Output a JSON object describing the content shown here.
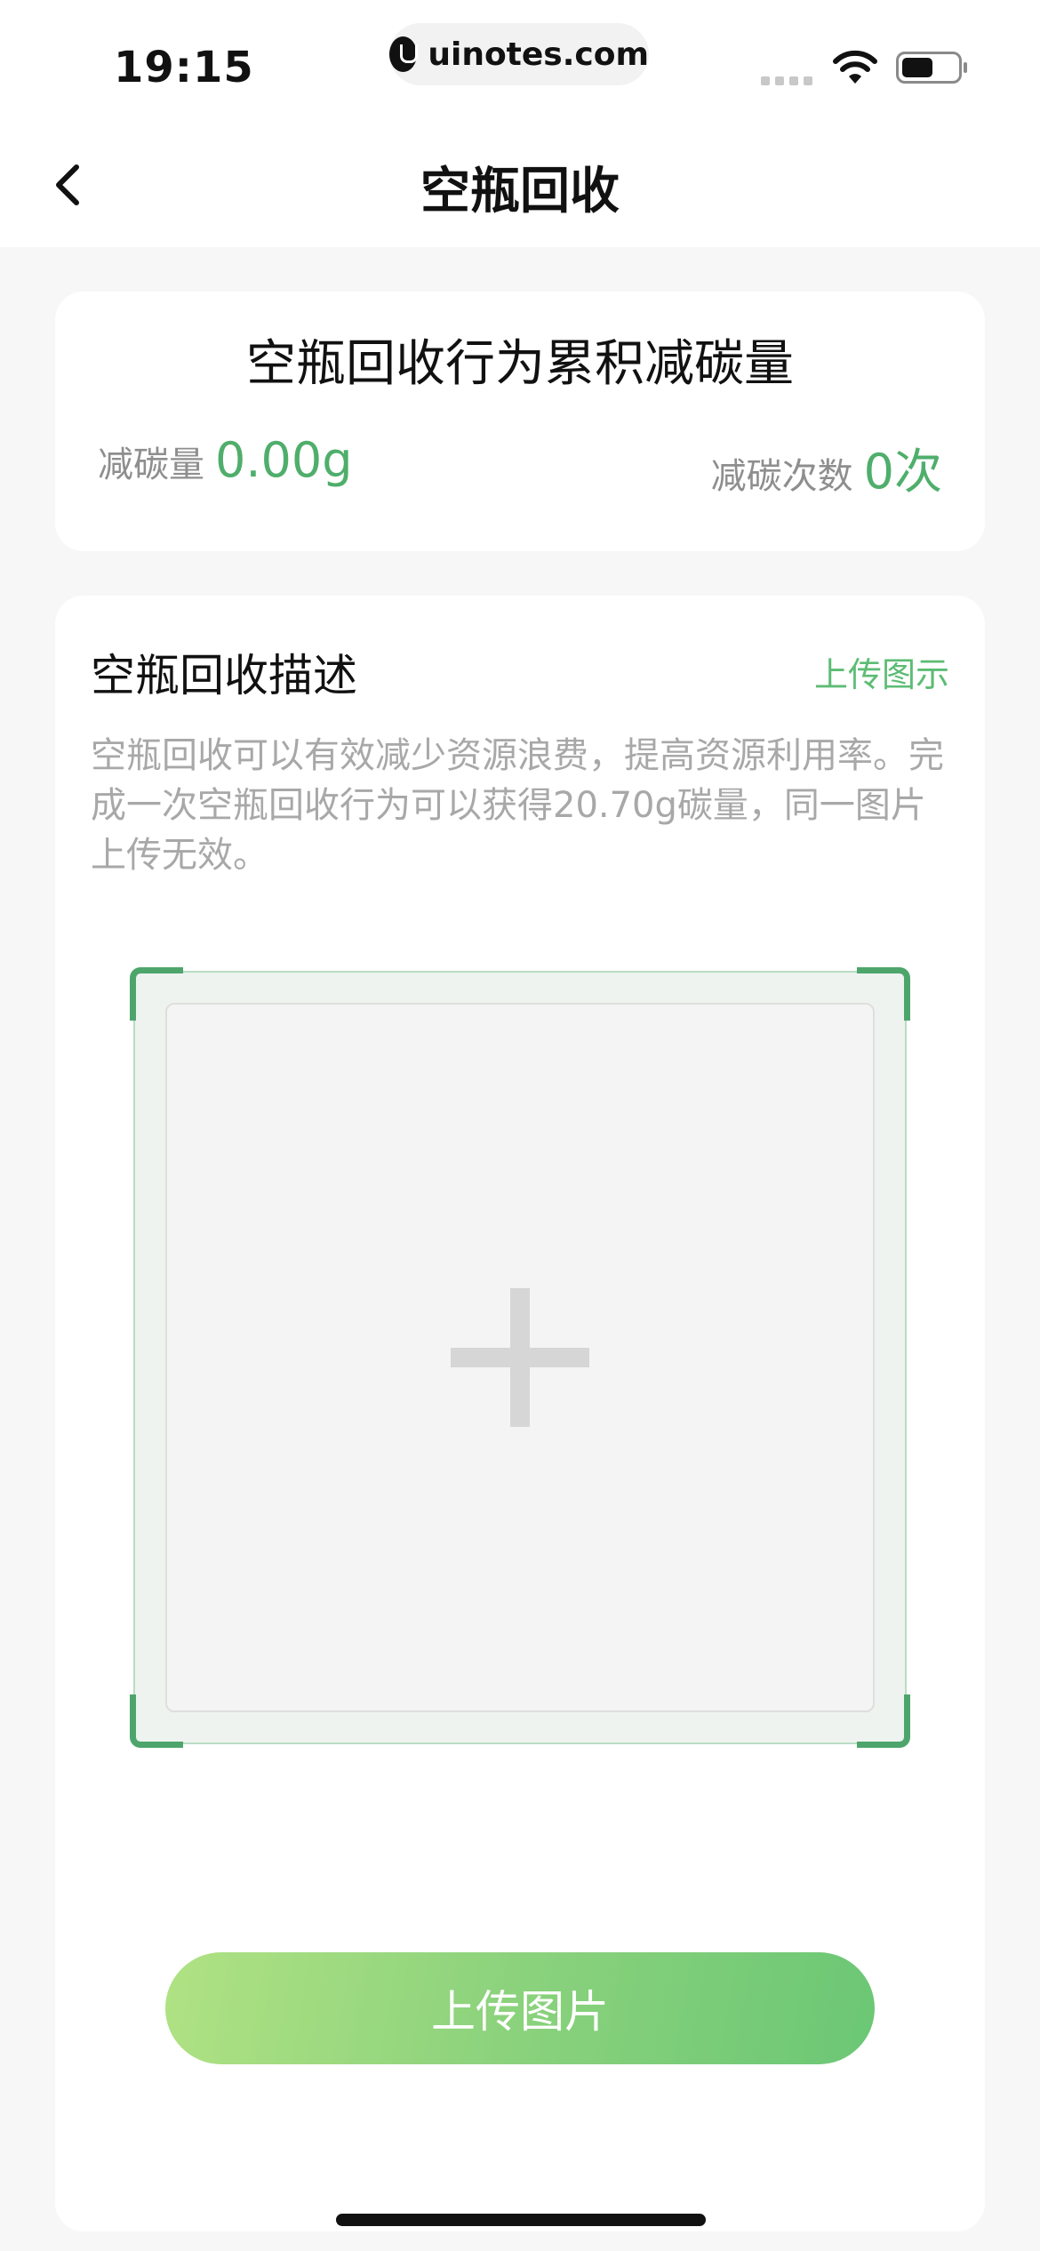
{
  "status_bar": {
    "time": "19:15",
    "url": "uinotes.com"
  },
  "nav": {
    "title": "空瓶回收"
  },
  "stats": {
    "title": "空瓶回收行为累积减碳量",
    "reduction_label": "减碳量",
    "reduction_value": "0.00g",
    "count_label": "减碳次数",
    "count_value": "0次"
  },
  "description": {
    "title": "空瓶回收描述",
    "example_link": "上传图示",
    "text": "空瓶回收可以有效减少资源浪费，提高资源利用率。完成一次空瓶回收行为可以获得20.70g碳量，同一图片上传无效。"
  },
  "upload": {
    "button_label": "上传图片"
  },
  "colors": {
    "accent": "#4fae6b",
    "button_start": "#b0e283",
    "button_end": "#6bc775"
  }
}
